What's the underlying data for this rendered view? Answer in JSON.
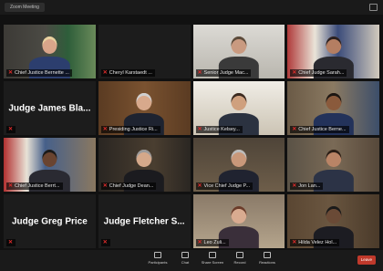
{
  "window": {
    "title": "Zoom Meeting"
  },
  "participants": [
    {
      "name": "Chief Justice Bernette ...",
      "video": true,
      "muted": true,
      "theme": "green"
    },
    {
      "name": "Cheryl Karstaedt ...",
      "video": false,
      "muted": true
    },
    {
      "name": "Senior Judge Mac...",
      "video": true,
      "muted": true,
      "theme": "light"
    },
    {
      "name": "Chief Judge Sarah...",
      "video": true,
      "muted": true,
      "theme": "flag"
    },
    {
      "name": "Judge James Bla...",
      "video": false,
      "muted": true,
      "center": true
    },
    {
      "name": "Presiding Justice Ri...",
      "video": true,
      "muted": true,
      "theme": "wood"
    },
    {
      "name": "Justice Kelsey...",
      "video": true,
      "muted": true,
      "theme": "bright"
    },
    {
      "name": "Chief Justice Berne...",
      "video": true,
      "muted": true,
      "theme": "office",
      "active": true
    },
    {
      "name": "Chief Justice Berrt...",
      "video": true,
      "muted": true,
      "theme": "flag2"
    },
    {
      "name": "Chief Judge Dean...",
      "video": true,
      "muted": true,
      "theme": "dark"
    },
    {
      "name": "Vice Chief Judge P...",
      "video": true,
      "muted": true,
      "theme": "shelf"
    },
    {
      "name": "Jon Lan...",
      "video": true,
      "muted": true,
      "theme": "office2"
    },
    {
      "name": "Judge Greg Price",
      "video": false,
      "muted": true,
      "center": true
    },
    {
      "name": "Judge Fletcher S...",
      "video": false,
      "muted": true,
      "center": true
    },
    {
      "name": "Leo Zuli...",
      "video": true,
      "muted": true,
      "theme": "warm"
    },
    {
      "name": "Hilda Velez Hol...",
      "video": true,
      "muted": true,
      "theme": "seal"
    }
  ],
  "toolbar": {
    "buttons": [
      {
        "label": "Participants",
        "icon": "participants-icon"
      },
      {
        "label": "Chat",
        "icon": "chat-icon"
      },
      {
        "label": "Share Screen",
        "icon": "share-screen-icon"
      },
      {
        "label": "Record",
        "icon": "record-icon"
      },
      {
        "label": "Reactions",
        "icon": "reactions-icon"
      }
    ],
    "leave_label": "Leave"
  },
  "colors": {
    "active_speaker": "#9acd32",
    "muted": "#e02b2b",
    "background": "#111111"
  }
}
